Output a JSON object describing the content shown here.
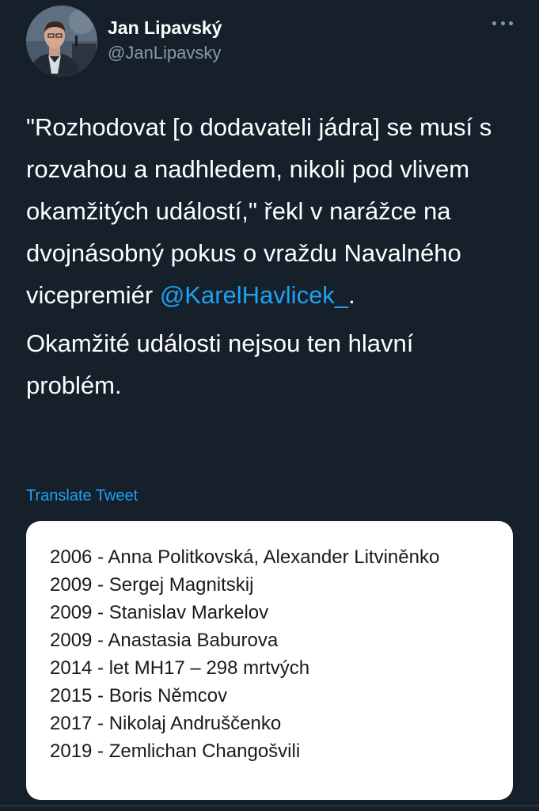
{
  "author": {
    "display_name": "Jan Lipavský",
    "handle": "@JanLipavsky"
  },
  "tweet": {
    "paragraph1_text": "\"Rozhodovat [o dodavateli jádra] se musí s rozvahou a nadhledem, nikoli pod vlivem okamžitých událostí,\" řekl v narážce na dvojnásobný pokus o vraždu Navalného vicepremiér ",
    "mention": "@KarelHavlicek_",
    "paragraph1_end": ".",
    "paragraph2_text": "Okamžité události nejsou ten hlavní problém.",
    "translate_label": "Translate Tweet"
  },
  "card": {
    "lines": [
      "2006 - Anna Politkovská, Alexander Litviněnko",
      "2009 - Sergej Magnitskij",
      "2009 - Stanislav Markelov",
      "2009 - Anastasia Baburova",
      "2014 - let MH17 – 298 mrtvých",
      "2015 - Boris Němcov",
      "2017 - Nikolaj Andruščenko",
      "2019 - Zemlichan Changošvili"
    ]
  },
  "colors": {
    "background": "#15202b",
    "link": "#1da1f2",
    "secondary_text": "#8899a6",
    "card_background": "#ffffff"
  },
  "icons": {
    "more": "more-options-icon"
  }
}
